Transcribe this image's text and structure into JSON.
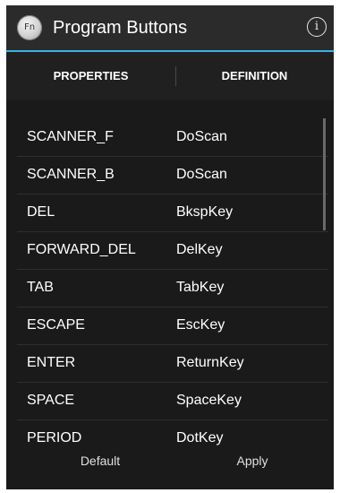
{
  "header": {
    "app_icon_text": "Fn",
    "title": "Program Buttons",
    "info_glyph": "i"
  },
  "tabs": [
    {
      "label": "PROPERTIES",
      "selected": true
    },
    {
      "label": "DEFINITION",
      "selected": false
    }
  ],
  "rows": [
    {
      "key": "SCANNER_F",
      "value": "DoScan"
    },
    {
      "key": "SCANNER_B",
      "value": "DoScan"
    },
    {
      "key": "DEL",
      "value": "BkspKey"
    },
    {
      "key": "FORWARD_DEL",
      "value": "DelKey"
    },
    {
      "key": "TAB",
      "value": "TabKey"
    },
    {
      "key": "ESCAPE",
      "value": "EscKey"
    },
    {
      "key": "ENTER",
      "value": "ReturnKey"
    },
    {
      "key": "SPACE",
      "value": "SpaceKey"
    },
    {
      "key": "PERIOD",
      "value": "DotKey"
    }
  ],
  "buttons": {
    "default_label": "Default",
    "apply_label": "Apply"
  },
  "icons": {
    "app": "fn-key-icon",
    "info": "info-icon"
  },
  "colors": {
    "accent": "#33b5e5",
    "background": "#000000",
    "action_bar": "#2b2b2b",
    "text": "#ffffff"
  }
}
